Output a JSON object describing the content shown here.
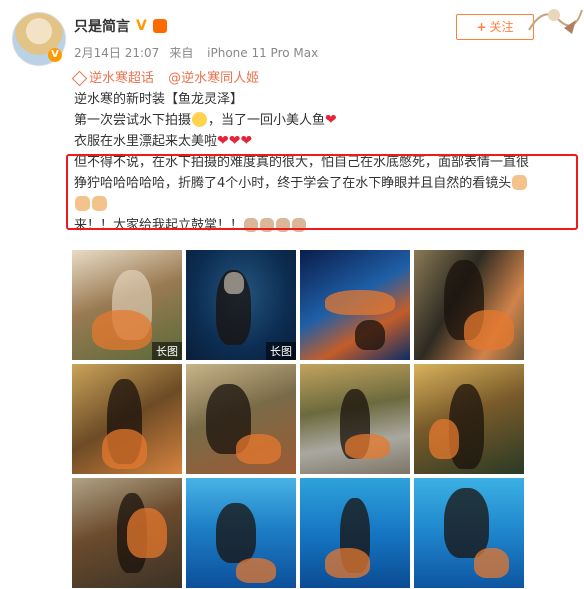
{
  "user": {
    "name": "只是简言",
    "vip_mark": "V",
    "avatar_badge": "V"
  },
  "meta": {
    "date": "2月14日 21:07",
    "source_prefix": "来自",
    "device": "iPhone 11 Pro Max"
  },
  "follow": {
    "label": "关注",
    "plus": "+"
  },
  "post": {
    "topic_1": "逆水寒超话",
    "topic_2": "@逆水寒同人姬",
    "line_1": "逆水寒的新时装【鱼龙灵泽】",
    "line_2a": "第一次尝试水下拍摄",
    "line_2b": "，当了一回小美人鱼",
    "line_3": "衣服在水里漂起来太美啦",
    "red_1": "但不得不说，在水下拍摄的难度真的很大，怕自己在水底憋死，面部表情一直很",
    "red_2": "狰狞哈哈哈哈哈，折腾了4个小时，终于学会了在水下睁眼并且自然的看镜头",
    "cheer": "来！！大家给我起立鼓掌！！"
  },
  "photos": {
    "long_label": "长图",
    "items": [
      {
        "kind": "landscape-orange",
        "long": true
      },
      {
        "kind": "underwater-dark",
        "long": true
      },
      {
        "kind": "underwater-fish",
        "long": false
      },
      {
        "kind": "rock-pose",
        "long": false
      },
      {
        "kind": "forest-seated",
        "long": false
      },
      {
        "kind": "shore-pose",
        "long": false
      },
      {
        "kind": "lake-seated",
        "long": false
      },
      {
        "kind": "autumn-pose",
        "long": false
      },
      {
        "kind": "dock-pose",
        "long": false
      },
      {
        "kind": "underwater-blue-1",
        "long": false
      },
      {
        "kind": "underwater-blue-2",
        "long": false
      },
      {
        "kind": "underwater-blue-3",
        "long": false
      }
    ]
  },
  "colors": {
    "topic": "#eb7350",
    "highlight_border": "#ee1b1b",
    "follow": "#ff8140"
  }
}
